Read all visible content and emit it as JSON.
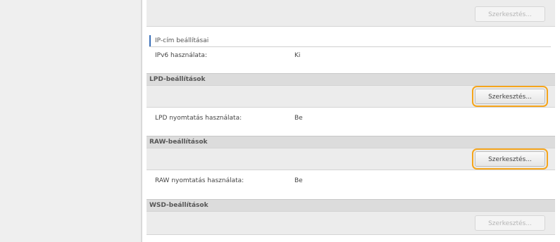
{
  "ip_section": {
    "edit_label": "Szerkesztés...",
    "title": "IP-cím beállításai",
    "row_label": "IPv6 használata:",
    "row_value": "Ki"
  },
  "lpd_section": {
    "header": "LPD-beállítások",
    "edit_label": "Szerkesztés...",
    "row_label": "LPD nyomtatás használata:",
    "row_value": "Be"
  },
  "raw_section": {
    "header": "RAW-beállítások",
    "edit_label": "Szerkesztés...",
    "row_label": "RAW nyomtatás használata:",
    "row_value": "Be"
  },
  "wsd_section": {
    "header": "WSD-beállítások",
    "edit_label": "Szerkesztés..."
  },
  "colors": {
    "highlight": "#f5a51c",
    "section_marker": "#3a6fb8"
  }
}
